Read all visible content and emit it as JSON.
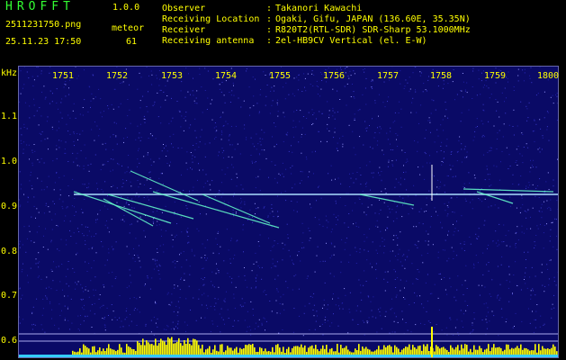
{
  "header": {
    "app_name": "HROFFT",
    "version": "1.0.0",
    "filename": "2511231750.png",
    "datetime": "25.11.23 17:50",
    "meteor_label": "meteor",
    "meteor_count": "61",
    "observer_label": "Observer",
    "observer_value": "Takanori Kawachi",
    "location_label": "Receiving Location",
    "location_value": "Ogaki, Gifu, JAPAN (136.60E, 35.35N)",
    "receiver_label": "Receiver",
    "receiver_value": "R820T2(RTL-SDR) SDR-Sharp 53.1000MHz",
    "antenna_label": "Receiving antenna",
    "antenna_value": "2el-HB9CV Vertical (el. E-W)",
    "colon": ":"
  },
  "axes": {
    "x_ticks": [
      "1751",
      "1752",
      "1753",
      "1754",
      "1755",
      "1756",
      "1757",
      "1758",
      "1759",
      "1800"
    ],
    "y_unit": "kHz",
    "y_ticks": [
      "1.1",
      "1.0",
      "0.9",
      "0.8",
      "0.7",
      "0.6"
    ]
  },
  "colors": {
    "background": "#0a0a66",
    "text": "#ffff00",
    "title": "#33ff33",
    "carrier": "#aaddff",
    "meteor": "#66ffcc",
    "audio_bars": "#ffff00",
    "audio_base": "#33ccff"
  }
}
